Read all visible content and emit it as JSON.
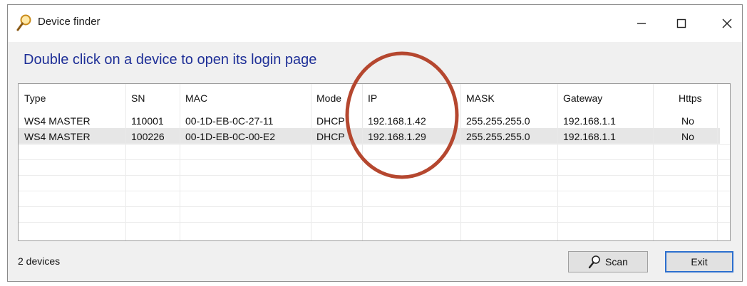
{
  "window": {
    "title": "Device finder",
    "controls": {
      "minimize": "—",
      "maximize": "☐",
      "close": "✕"
    }
  },
  "heading": "Double click on a device to open its login page",
  "table": {
    "columns": [
      "Type",
      "SN",
      "MAC",
      "Mode",
      "IP",
      "MASK",
      "Gateway",
      "Https"
    ],
    "rows": [
      {
        "type": "WS4 MASTER",
        "sn": "110001",
        "mac": "00-1D-EB-0C-27-11",
        "mode": "DHCP",
        "ip": "192.168.1.42",
        "mask": "255.255.255.0",
        "gateway": "192.168.1.1",
        "https": "No"
      },
      {
        "type": "WS4 MASTER",
        "sn": "100226",
        "mac": "00-1D-EB-0C-00-E2",
        "mode": "DHCP",
        "ip": "192.168.1.29",
        "mask": "255.255.255.0",
        "gateway": "192.168.1.1",
        "https": "No",
        "selected": true
      }
    ]
  },
  "status": "2 devices",
  "buttons": {
    "scan": "Scan",
    "exit": "Exit"
  },
  "colors": {
    "heading": "#1e2f97",
    "annotation_circle": "#b5472f",
    "exit_border": "#2c6fce"
  },
  "icons": {
    "app": "magnifier-icon",
    "scan": "magnifier-icon"
  }
}
